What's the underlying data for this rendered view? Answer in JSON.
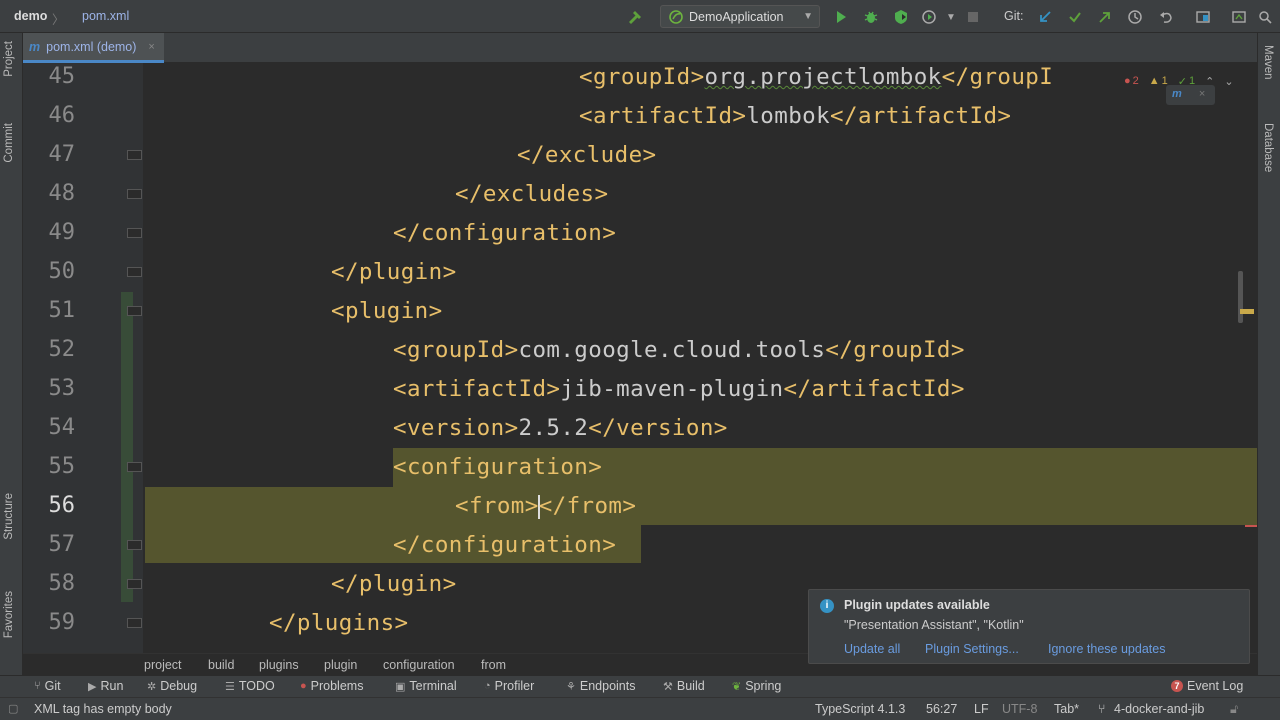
{
  "navbar": {
    "project": "demo",
    "separator": "〉",
    "file": "pom.xml",
    "run_config": "DemoApplication",
    "git_label": "Git:"
  },
  "left_strip": {
    "project": "Project",
    "commit": "Commit",
    "structure": "Structure",
    "favorites": "Favorites"
  },
  "right_strip": {
    "maven": "Maven",
    "database": "Database"
  },
  "editor_tab": {
    "icon_letter": "m",
    "label": "pom.xml (demo)",
    "close": "×"
  },
  "inspections": {
    "errors": "2",
    "warnings": "1",
    "ok": "1"
  },
  "maven_reload": "m",
  "lines": [
    {
      "num": "45",
      "code": "<groupId>org.projectlombok</groupI"
    },
    {
      "num": "46",
      "code": "<artifactId>lombok</artifactId>"
    },
    {
      "num": "47",
      "code": "</exclude>"
    },
    {
      "num": "48",
      "code": "</excludes>"
    },
    {
      "num": "49",
      "code": "</configuration>"
    },
    {
      "num": "50",
      "code": "</plugin>"
    },
    {
      "num": "51",
      "code": "<plugin>"
    },
    {
      "num": "52",
      "code": "<groupId>com.google.cloud.tools</groupId>"
    },
    {
      "num": "53",
      "code": "<artifactId>jib-maven-plugin</artifactId>"
    },
    {
      "num": "54",
      "code": "<version>2.5.2</version>"
    },
    {
      "num": "55",
      "code": "<configuration>"
    },
    {
      "num": "56",
      "code": "<from></from>"
    },
    {
      "num": "57",
      "code": "</configuration>"
    },
    {
      "num": "58",
      "code": "</plugin>"
    },
    {
      "num": "59",
      "code": "</plugins>"
    }
  ],
  "code_tokens": {
    "l45_open": "<groupId>",
    "l45_text": "org.projectlombok",
    "l45_close": "</groupI",
    "l46_open": "<artifactId>",
    "l46_text": "lombok",
    "l46_close": "</artifactId>",
    "l52_open": "<groupId>",
    "l52_text": "com.google.cloud.tools",
    "l52_close": "</groupId>",
    "l53_open": "<artifactId>",
    "l53_text": "jib-maven-plugin",
    "l53_close": "</artifactId>",
    "l54_open": "<version>",
    "l54_text": "2.5.2",
    "l54_close": "</version>",
    "l56_open": "<from>",
    "l56_close": "</from>"
  },
  "breadcrumbs": [
    "project",
    "build",
    "plugins",
    "plugin",
    "configuration",
    "from"
  ],
  "notification": {
    "title": "Plugin updates available",
    "body": "\"Presentation Assistant\", \"Kotlin\"",
    "links": [
      "Update all",
      "Plugin Settings...",
      "Ignore these updates"
    ]
  },
  "tool_windows": {
    "git": "Git",
    "run": "Run",
    "debug": "Debug",
    "todo": "TODO",
    "problems": "Problems",
    "terminal": "Terminal",
    "profiler": "Profiler",
    "endpoints": "Endpoints",
    "build": "Build",
    "spring": "Spring",
    "event_log_count": "7",
    "event_log": "Event Log"
  },
  "status": {
    "message": "XML tag has empty body",
    "language": "TypeScript 4.1.3",
    "position": "56:27",
    "line_sep": "LF",
    "encoding": "UTF-8",
    "indent": "Tab*",
    "branch": "4-docker-and-jib"
  },
  "colors": {
    "tag": "#e8bf6a",
    "text": "#cccccc",
    "accent": "#4a88c7",
    "error": "#c75450",
    "warning": "#c9a94a",
    "success": "#5ea13b"
  }
}
